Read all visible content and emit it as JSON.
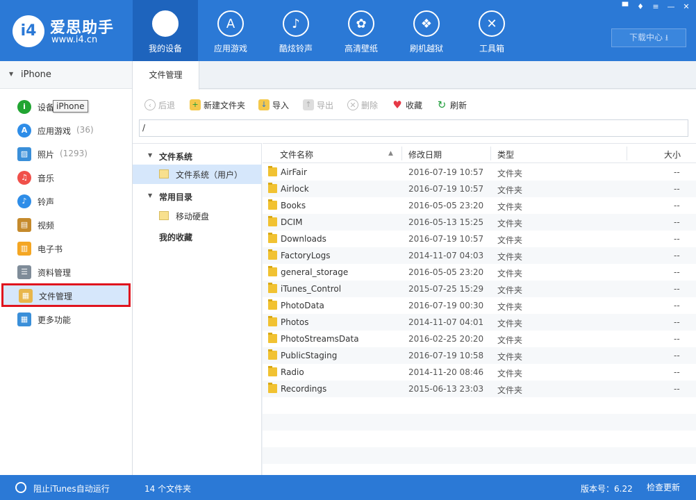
{
  "app": {
    "name": "爱思助手",
    "url": "www.i4.cn",
    "logo_text": "i4"
  },
  "nav": [
    {
      "label": "我的设备",
      "icon": "apple-icon",
      "glyph": ""
    },
    {
      "label": "应用游戏",
      "icon": "app-store-icon",
      "glyph": "A"
    },
    {
      "label": "酷炫铃声",
      "icon": "bell-icon",
      "glyph": "♪"
    },
    {
      "label": "高清壁纸",
      "icon": "flower-icon",
      "glyph": "✿"
    },
    {
      "label": "刷机越狱",
      "icon": "dropbox-icon",
      "glyph": "❖"
    },
    {
      "label": "工具箱",
      "icon": "tools-icon",
      "glyph": "✕"
    }
  ],
  "window": {
    "download_center": "下载中心 ⭳"
  },
  "device": {
    "name": "iPhone"
  },
  "sidebar": {
    "items": [
      {
        "label": "设备",
        "count": "",
        "icon": "info-icon",
        "glyph": "i",
        "color": "#21a532"
      },
      {
        "label": "应用游戏",
        "count": "(36)",
        "icon": "app-store-icon",
        "glyph": "A",
        "color": "#2e8de8"
      },
      {
        "label": "照片",
        "count": "(1293)",
        "icon": "photo-icon",
        "glyph": "▨",
        "color": "#3a8fd9"
      },
      {
        "label": "音乐",
        "count": "",
        "icon": "music-icon",
        "glyph": "♫",
        "color": "#f0504a"
      },
      {
        "label": "铃声",
        "count": "",
        "icon": "bell-icon",
        "glyph": "♪",
        "color": "#2e8de8"
      },
      {
        "label": "视频",
        "count": "",
        "icon": "film-icon",
        "glyph": "▤",
        "color": "#c58a2c"
      },
      {
        "label": "电子书",
        "count": "",
        "icon": "book-icon",
        "glyph": "▥",
        "color": "#f4a623"
      },
      {
        "label": "资料管理",
        "count": "",
        "icon": "contacts-icon",
        "glyph": "☰",
        "color": "#7f8c99"
      },
      {
        "label": "文件管理",
        "count": "",
        "icon": "files-icon",
        "glyph": "▦",
        "color": "#e8b64b"
      },
      {
        "label": "更多功能",
        "count": "",
        "icon": "grid-icon",
        "glyph": "▦",
        "color": "#3a8fd9"
      }
    ],
    "tooltip": "iPhone"
  },
  "tab": {
    "label": "文件管理"
  },
  "toolbar": {
    "back": "后退",
    "new_folder": "新建文件夹",
    "import": "导入",
    "export": "导出",
    "delete": "删除",
    "favorite": "收藏",
    "refresh": "刷新"
  },
  "path": {
    "value": "/"
  },
  "tree": {
    "filesystem": "文件系统",
    "filesystem_user": "文件系统（用户）",
    "common": "常用目录",
    "mobile_disk": "移动硬盘",
    "favorites": "我的收藏"
  },
  "columns": {
    "name": "文件名称",
    "date": "修改日期",
    "type": "类型",
    "size": "大小"
  },
  "files": [
    {
      "name": "AirFair",
      "date": "2016-07-19 10:57",
      "type": "文件夹",
      "size": "--"
    },
    {
      "name": "Airlock",
      "date": "2016-07-19 10:57",
      "type": "文件夹",
      "size": "--"
    },
    {
      "name": "Books",
      "date": "2016-05-05 23:20",
      "type": "文件夹",
      "size": "--"
    },
    {
      "name": "DCIM",
      "date": "2016-05-13 15:25",
      "type": "文件夹",
      "size": "--"
    },
    {
      "name": "Downloads",
      "date": "2016-07-19 10:57",
      "type": "文件夹",
      "size": "--"
    },
    {
      "name": "FactoryLogs",
      "date": "2014-11-07 04:03",
      "type": "文件夹",
      "size": "--"
    },
    {
      "name": "general_storage",
      "date": "2016-05-05 23:20",
      "type": "文件夹",
      "size": "--"
    },
    {
      "name": "iTunes_Control",
      "date": "2015-07-25 15:29",
      "type": "文件夹",
      "size": "--"
    },
    {
      "name": "PhotoData",
      "date": "2016-07-19 00:30",
      "type": "文件夹",
      "size": "--"
    },
    {
      "name": "Photos",
      "date": "2014-11-07 04:01",
      "type": "文件夹",
      "size": "--"
    },
    {
      "name": "PhotoStreamsData",
      "date": "2016-02-25 20:20",
      "type": "文件夹",
      "size": "--"
    },
    {
      "name": "PublicStaging",
      "date": "2016-07-19 10:58",
      "type": "文件夹",
      "size": "--"
    },
    {
      "name": "Radio",
      "date": "2014-11-20 08:46",
      "type": "文件夹",
      "size": "--"
    },
    {
      "name": "Recordings",
      "date": "2015-06-13 23:03",
      "type": "文件夹",
      "size": "--"
    }
  ],
  "status": {
    "itunes": "阻止iTunes自动运行",
    "count": "14 个文件夹",
    "version": "版本号：6.22",
    "check": "检查更新"
  },
  "colors": {
    "brand": "#2b79d6",
    "nav_active": "#1e64bd",
    "highlight": "#e0141e"
  }
}
